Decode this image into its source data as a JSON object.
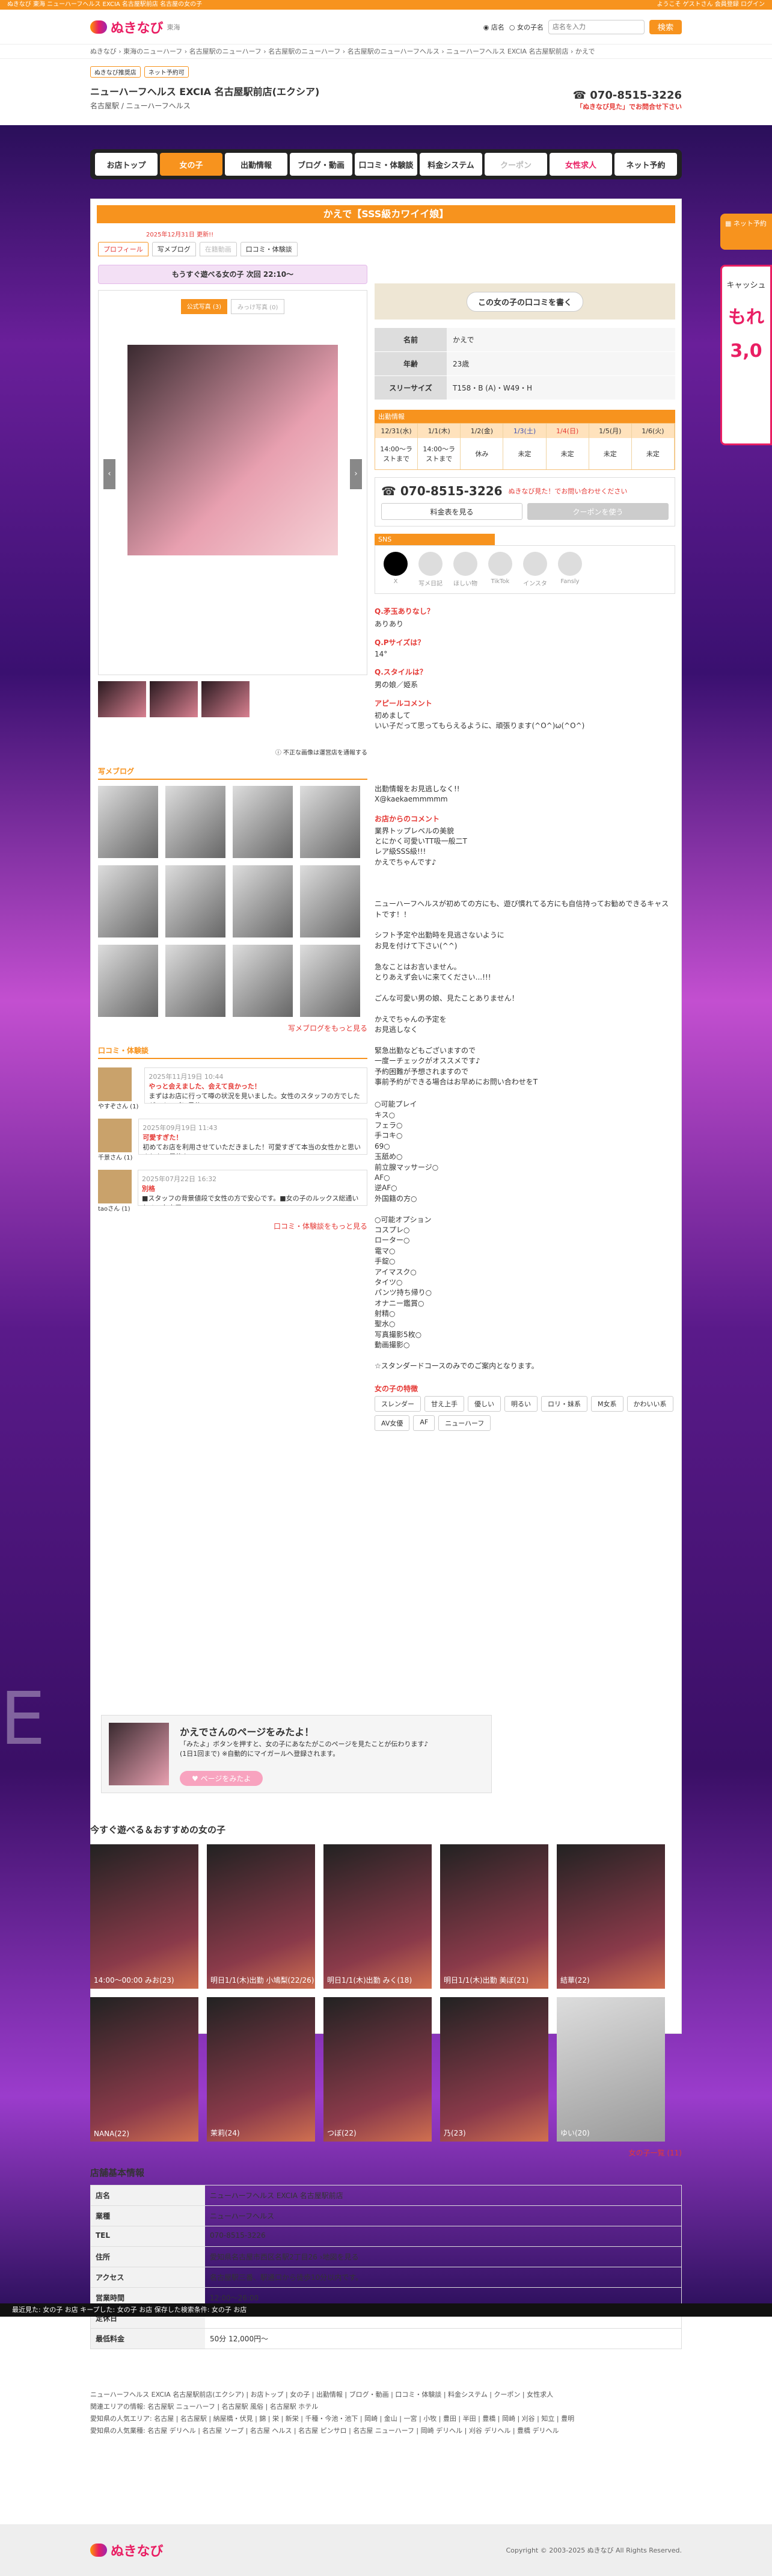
{
  "topstrip": {
    "left": "ぬきなび 東海 ニューハーフヘルス EXCIA 名古屋駅前店 名古屋の女の子",
    "right": "ようこそ ゲストさん 会員登録 ログイン"
  },
  "header": {
    "logo": "ぬきなび",
    "region": "東海",
    "search_placeholder": "店名を入力",
    "radio1": "店名",
    "radio2": "女の子名",
    "search_button": "検索"
  },
  "breadcrumb": "ぬきなび › 東海のニューハーフ › 名古屋駅のニューハーフ › 名古屋駅のニューハーフ › 名古屋駅のニューハーフヘルス › ニューハーフヘルス EXCIA 名古屋駅前店 › かえで",
  "shop": {
    "tag1": "ぬきなび推奨店",
    "tag2": "ネット予約可",
    "name": "ニューハーフヘルス EXCIA 名古屋駅前店(エクシア)",
    "sub": "名古屋駅 / ニューハーフヘルス",
    "tel": "070-8515-3226",
    "tel_note": "「ぬきなび見た」でお問合せ下さい"
  },
  "gnav": [
    "お店トップ",
    "女の子",
    "出勤情報",
    "ブログ・動画",
    "口コミ・体験談",
    "料金システム",
    "クーポン",
    "女性求人",
    "ネット予約"
  ],
  "title": "かえで【SSS級カワイイ娘】",
  "date_note": "2025年12月31日 更新!!",
  "subtabs": [
    "プロフィール",
    "写メブログ",
    "在籍動画",
    "口コミ・体験談"
  ],
  "next": "もうすぐ遊べる女の子 次回 22:10〜",
  "photo_tabs": [
    "公式写真 (3)",
    "みっけ写真 (0)"
  ],
  "photo_note": "不正な画像は運営店を通報する",
  "blog_head": "写メブログ",
  "blog_more": "写メブログをもっと見る",
  "reviews_head": "口コミ・体験談",
  "reviews": [
    {
      "name": "やすぞさん (1)",
      "date": "2025年11月19日 10:44",
      "title": "やっと会えました、会えて良かった！",
      "text": "まずはお店に行って噂の状況を見いました。女性のスタッフの方でしたがスムーズに予約..."
    },
    {
      "name": "千景さん (1)",
      "date": "2025年09月19日 11:43",
      "title": "可愛すぎた！",
      "text": "初めてお店を利用させていただきました！可愛すぎて本当の女性かと思いました。最後も..."
    },
    {
      "name": "taoさん (1)",
      "date": "2025年07月22日 16:32",
      "title": "別格",
      "text": "■スタッフの背景値段で女性の方で安心です。■女の子のルックス総通いなく、名古屋で..."
    }
  ],
  "reviews_more": "口コミ・体験談をもっと見る",
  "review_cta": "この女の子の口コミを書く",
  "profile": [
    {
      "k": "名前",
      "v": "かえで"
    },
    {
      "k": "年齢",
      "v": "23歳"
    },
    {
      "k": "スリーサイズ",
      "v": "T158・B (A)・W49・H"
    }
  ],
  "sched_head": "出勤情報",
  "sched": {
    "days": [
      "12/31(水)",
      "1/1(木)",
      "1/2(金)",
      "1/3(土)",
      "1/4(日)",
      "1/5(月)",
      "1/6(火)"
    ],
    "vals": [
      "14:00〜ラストまで",
      "14:00〜ラストまで",
      "休み",
      "未定",
      "未定",
      "未定",
      "未定"
    ]
  },
  "contact": {
    "tel": "070-8515-3226",
    "note": "ぬきなび見た！でお問い合わせください",
    "btn1": "料金表を見る",
    "btn2": "クーポンを使う"
  },
  "sns_head": "SNS",
  "sns": [
    "X",
    "写メ日記",
    "ほしい物",
    "TikTok",
    "インスタ",
    "Fansly"
  ],
  "qa": [
    {
      "q": "Q.矛玉ありなし？",
      "a": "ありあり"
    },
    {
      "q": "Q.Pサイズは？",
      "a": "14°"
    },
    {
      "q": "Q.スタイルは？",
      "a": "男の娘／姫系"
    }
  ],
  "appeal_head": "アピールコメント",
  "appeal": "初めまして\nいい子だって思ってもらえるように、頑張ります(^O^)ω(^O^)\n\n\n\n\n\n出勤情報をお見逃しなく!!\nX@kaekaemmmmm",
  "comment_head": "お店からのコメント",
  "comment": "業界トップレベルの美貌\nとにかく可愛いTT吸一般二T\nレア級SSS級!!!\nかえでちゃんです♪\n\n\n\nニューハーフヘルスが初めての方にも、遊び慣れてる方にも自信持ってお勧めできるキャストです！！\n\nシフト予定や出勤時を見逃さないように\nお見を付けて下さい(^^)\n\n急なことはお言いません。\nとりあえず会いに来てください...!!!\n\nごんな可愛い男の娘、見たことありません！\n\nかえでちゃんの予定を\nお見逃しなく\n\n緊急出勤などもございますので\n一度ーチェックがオススメです♪\n予約困難が予想されますので\n事前予約ができる場合はお早めにお問い合わせをT",
  "options": "○可能プレイ\nキス○\nフェラ○\n手コキ○\n69○\n玉舐め○\n前立腺マッサージ○\nAF○\n逆AF○\n外国籍の方○\n\n○可能オプション\nコスプレ○\nローター○\n電マ○\n手錠○\nアイマスク○\nタイツ○\nパンツ持ち帰り○\nオナニー鑑賞○\n射精○\n聖水○\n写真撮影5枚○\n動画撮影○\n\n☆スタンダードコースのみでのご案内となります。",
  "feature_head": "女の子の特徴",
  "features": [
    "スレンダー",
    "甘え上手",
    "優しい",
    "明るい",
    "ロリ・妹系",
    "M女系",
    "かわいい系",
    "AV女優",
    "AF",
    "ニューハーフ"
  ],
  "banner": {
    "title": "かえでさんのページをみたよ！",
    "text": "「みたよ」ボタンを押すと、女の子にあなたがこのページを見たことが伝わります♪\n(1日1回まで) ※自動的にマイガールへ登録されます。",
    "button": "ページをみたよ"
  },
  "rec_title": "今すぐ遊べる＆おすすめの女の子",
  "rec": [
    "14:00〜00:00 みお(23)",
    "明日1/1(木)出勤 小鳩梨(22/26)",
    "明日1/1(木)出勤 みく(18)",
    "明日1/1(木)出勤 美ぼ(21)",
    "結華(22)",
    "NANA(22)",
    "茉莉(24)",
    "つぼ(22)",
    "乃(23)",
    "ゆい(20)"
  ],
  "rec_more": "女の子一覧 (11)",
  "info_head": "店舗基本情報",
  "info": [
    {
      "k": "店名",
      "v": "ニューハーフヘルス EXCIA 名古屋駅前店"
    },
    {
      "k": "業種",
      "v": "ニューハーフヘルス"
    },
    {
      "k": "TEL",
      "v": "070-8515-3226"
    },
    {
      "k": "住所",
      "v": "愛知県名古屋市西区名駅2丁目26 ›地図を見る"
    },
    {
      "k": "アクセス",
      "v": "名古屋駅三番、駅通口から徒歩10分以内です。"
    },
    {
      "k": "営業時間",
      "v": "12:00〜26:00"
    },
    {
      "k": "定休日",
      "v": ""
    },
    {
      "k": "最低料金",
      "v": "50分 12,000円〜"
    }
  ],
  "footbar": "最近見た: 女の子 お店 キープした: 女の子 お店 保存した検索条件: 女の子 お店",
  "footnav": "ニューハーフヘルス EXCIA 名古屋駅前店(エクシア) | お店トップ | 女の子 | 出勤情報 | ブログ・動画 | 口コミ・体験談 | 料金システム | クーポン | 女性求人\n関連エリアの情報: 名古屋駅 ニューハーフ | 名古屋駅 風俗 | 名古屋駅 ホテル\n愛知県の人気エリア: 名古屋 | 名古屋駅 | 納屋橋・伏見 | 錦 | 栄 | 新栄 | 千種・今池・池下 | 岡崎 | 金山 | 一宮 | 小牧 | 豊田 | 半田 | 豊橋 | 岡崎 | 刈谷 | 知立 | 豊明\n愛知県の人気業種: 名古屋 デリヘル | 名古屋 ソープ | 名古屋 ヘルス | 名古屋 ピンサロ | 名古屋 ニューハーフ | 岡崎 デリヘル | 刈谷 デリヘル | 豊橋 デリヘル",
  "copy": "Copyright © 2003-2025 ぬきなび All Rights Reserved.",
  "rightad": {
    "a": "ネット予約",
    "b": "キャッシュ",
    "c": "もれ",
    "d": "3,0"
  },
  "watermark": "E W                                          L T"
}
